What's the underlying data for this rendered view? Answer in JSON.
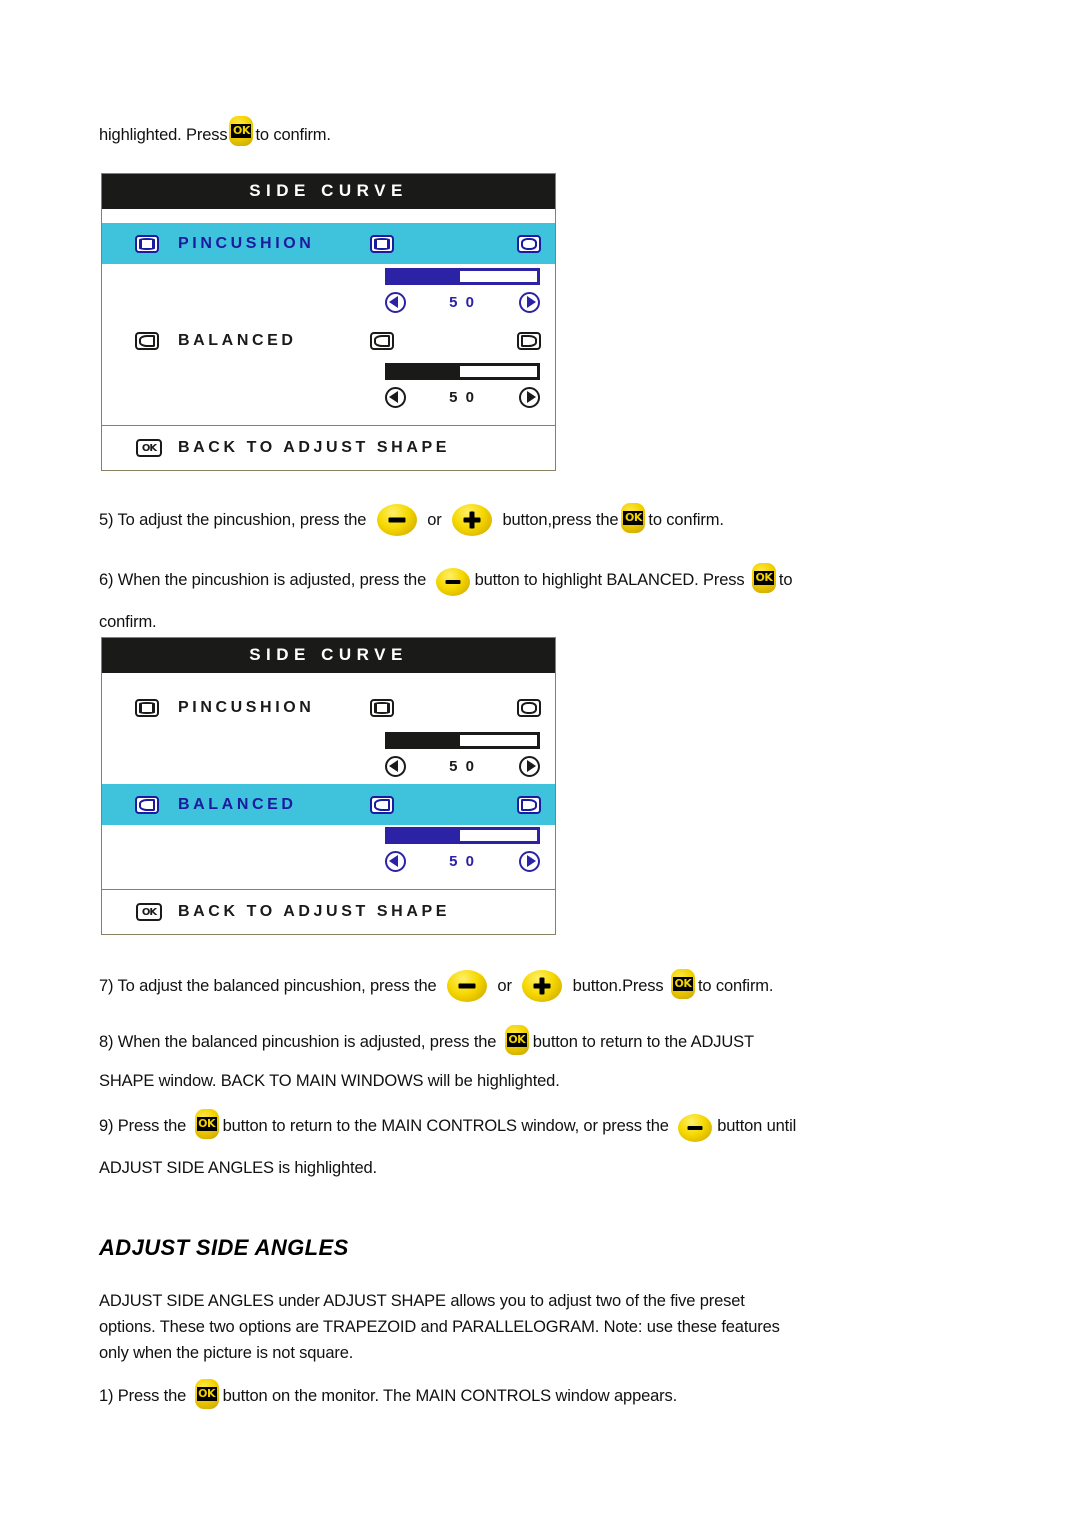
{
  "document": {
    "paragraphs": {
      "p_top": "highlighted. Press [OK] to confirm.",
      "p5_a": "5) To adjust the pincushion, press the",
      "p5_or": "or",
      "p5_b": "button,press the",
      "p5_c": "to confirm.",
      "p6_a": "6) When the pincushion is adjusted, press the",
      "p6_b": "button to highlight BALANCED. Press",
      "p6_c": "to",
      "p6_d": "confirm.",
      "p7_a": "7) To adjust the balanced pincushion, press the",
      "p7_or": "or",
      "p7_b": "button.Press",
      "p7_c": "to confirm.",
      "p8_a": "8) When the balanced pincushion is adjusted, press the",
      "p8_b": "button to return to the ADJUST",
      "p8_line2": "SHAPE window. BACK TO MAIN WINDOWS will be highlighted.",
      "p9_a": "9) Press the",
      "p9_b": "button to return to the MAIN CONTROLS window, or press the",
      "p9_c": "button until",
      "p9_line2": "ADJUST SIDE ANGLES is highlighted.",
      "p_top_a": "highlighted. Press",
      "p_top_b": "to confirm.",
      "heading": "ADJUST SIDE ANGLES",
      "body_line1": "ADJUST SIDE ANGLES under ADJUST SHAPE allows you to adjust two of the five preset",
      "body_line2": "options. These two options are TRAPEZOID and PARALLELOGRAM. Note: use these features",
      "body_line3": "only when the picture is not square.",
      "p1_a": "1) Press the",
      "p1_b": "button on the monitor. The MAIN CONTROLS window appears."
    }
  },
  "icons": {
    "ok_label": "OK",
    "minus_name": "minus-button-icon",
    "plus_name": "plus-button-icon",
    "ok_name": "ok-button-icon"
  },
  "osd_menu_1": {
    "title": "SIDE CURVE",
    "rows": [
      {
        "label": "PINCUSHION",
        "highlighted": true,
        "left_icon": "pincushion-icon",
        "right_icon_a": "pincushion-icon",
        "right_icon_b": "barrel-icon",
        "value": "5 0",
        "fill_percent": 48
      },
      {
        "label": "BALANCED",
        "highlighted": false,
        "left_icon": "balanced-left-icon",
        "right_icon_a": "balanced-left-icon",
        "right_icon_b": "balanced-right-icon",
        "value": "5 0",
        "fill_percent": 48
      }
    ],
    "footer": {
      "label": "BACK TO ADJUST SHAPE",
      "icon": "ok-glyph-icon",
      "icon_text": "OK"
    }
  },
  "osd_menu_2": {
    "title": "SIDE CURVE",
    "rows": [
      {
        "label": "PINCUSHION",
        "highlighted": false,
        "left_icon": "pincushion-icon",
        "right_icon_a": "pincushion-icon",
        "right_icon_b": "barrel-icon",
        "value": "5 0",
        "fill_percent": 48
      },
      {
        "label": "BALANCED",
        "highlighted": true,
        "left_icon": "balanced-left-icon",
        "right_icon_a": "balanced-left-icon",
        "right_icon_b": "balanced-right-icon",
        "value": "5 0",
        "fill_percent": 48
      }
    ],
    "footer": {
      "label": "BACK TO ADJUST SHAPE",
      "icon": "ok-glyph-icon",
      "icon_text": "OK"
    }
  },
  "colors": {
    "highlight": "#3fc2dc",
    "highlight_text": "#1c1a9e",
    "title_bar": "#1a1a18",
    "button_yellow": "#f6d800",
    "menu_border": "#8a7f63"
  }
}
